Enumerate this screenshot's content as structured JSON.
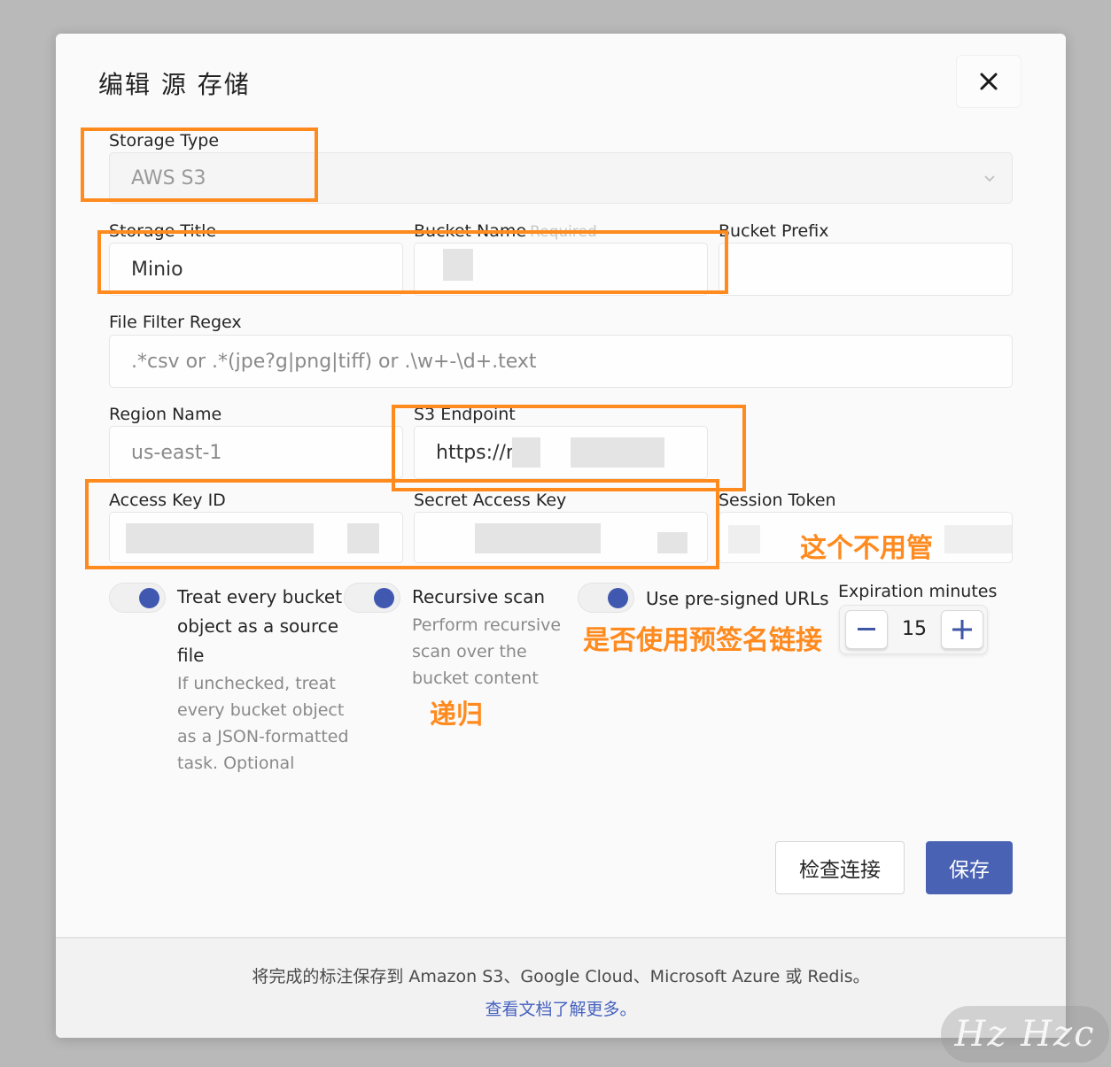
{
  "dialog": {
    "title": "编辑 源 存储",
    "close_symbol": "✕"
  },
  "fields": {
    "storage_type": {
      "label": "Storage Type",
      "value": "AWS S3"
    },
    "storage_title": {
      "label": "Storage Title",
      "value": "Minio"
    },
    "bucket_name": {
      "label": "Bucket Name",
      "required": "Required"
    },
    "bucket_prefix": {
      "label": "Bucket Prefix"
    },
    "file_filter_regex": {
      "label": "File Filter Regex",
      "placeholder": ".*csv or .*(jpe?g|png|tiff) or .\\w+-\\d+.text"
    },
    "region_name": {
      "label": "Region Name",
      "value": "us-east-1"
    },
    "s3_endpoint": {
      "label": "S3 Endpoint",
      "value": "https://r"
    },
    "access_key_id": {
      "label": "Access Key ID"
    },
    "secret_access_key": {
      "label": "Secret Access Key"
    },
    "session_token": {
      "label": "Session Token"
    }
  },
  "options": {
    "treat_as_source": {
      "title": "Treat every bucket object as a source file",
      "description": "If unchecked, treat every bucket object as a JSON-formatted task. Optional",
      "checked": true
    },
    "recursive_scan": {
      "title": "Recursive scan",
      "description": "Perform recursive scan over the bucket content",
      "checked": true
    },
    "presigned_urls": {
      "title": "Use pre-signed URLs",
      "checked": true
    },
    "expiration": {
      "label": "Expiration minutes",
      "value": "15",
      "minus": "−",
      "plus": "+"
    }
  },
  "buttons": {
    "check_connection": "检查连接",
    "save": "保存"
  },
  "footer": {
    "text": "将完成的标注保存到 Amazon S3、Google Cloud、Microsoft Azure 或 Redis。",
    "link": "查看文档了解更多。"
  },
  "annotations": {
    "session_token_note": "这个不用管",
    "presigned_note": "是否使用预签名链接",
    "recursive_note": "递归"
  },
  "watermark": "Hz Hzc",
  "colors": {
    "accent": "#4a62b4",
    "toggle_knob": "#4058b0",
    "highlight": "#ff8a1e",
    "link": "#4662c0"
  }
}
